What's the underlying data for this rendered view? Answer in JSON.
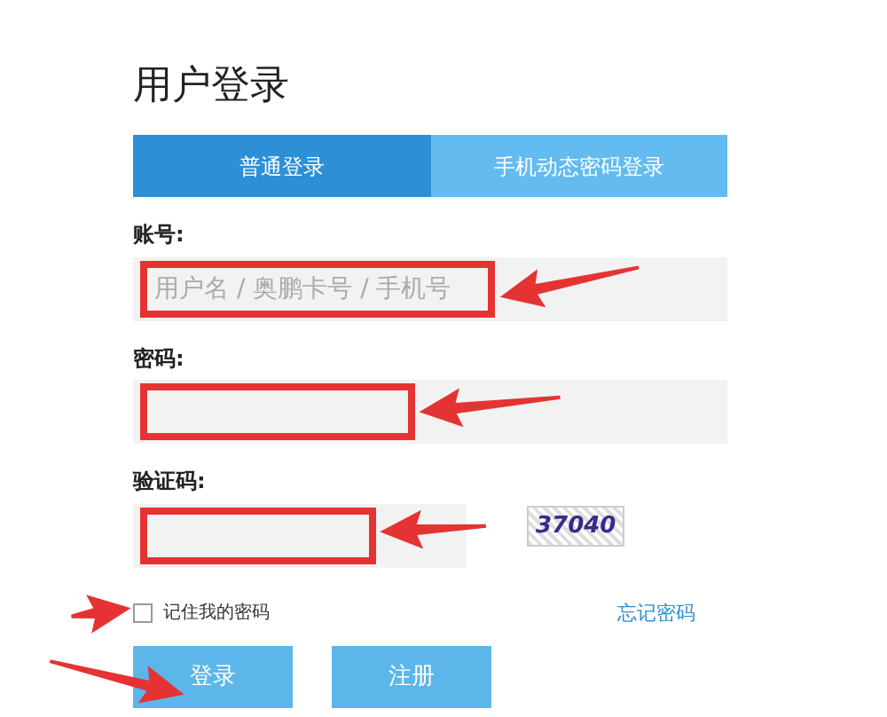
{
  "title": "用户登录",
  "tabs": [
    {
      "label": "普通登录",
      "selected": true
    },
    {
      "label": "手机动态密码登录",
      "selected": false
    }
  ],
  "fields": [
    {
      "label": "账号:",
      "placeholder": "用户名 / 奥鹏卡号 / 手机号",
      "highlighted": true,
      "kind": "text"
    },
    {
      "label": "密码:",
      "highlighted": true,
      "kind": "password"
    },
    {
      "label": "验证码:",
      "highlighted": true,
      "kind": "captcha",
      "captcha": "37040"
    }
  ],
  "remember": {
    "label": "记住我的密码",
    "checked": false,
    "pointed": true
  },
  "forgot_link": "忘记密码",
  "buttons": [
    {
      "label": "登录",
      "pointed": true
    },
    {
      "label": "注册",
      "pointed": false
    }
  ]
}
